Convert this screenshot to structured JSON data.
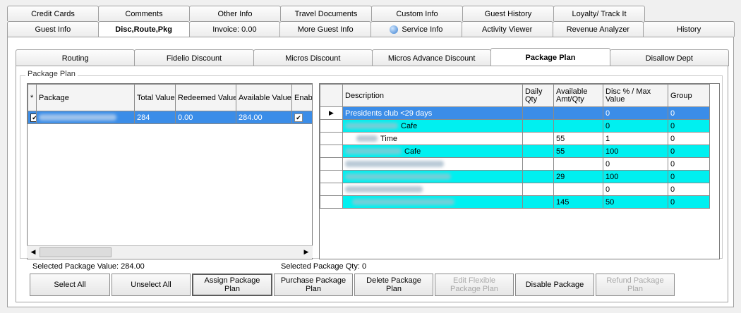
{
  "tabs_row1": [
    "Credit Cards",
    "Comments",
    "Other Info",
    "Travel Documents",
    "Custom Info",
    "Guest History",
    "Loyalty/ Track It",
    ""
  ],
  "tabs_row2": [
    "Guest Info",
    "Disc,Route,Pkg",
    "Invoice: 0.00",
    "More Guest Info",
    "Service Info",
    "Activity Viewer",
    "Revenue Analyzer",
    "History"
  ],
  "subtabs": [
    "Routing",
    "Fidelio Discount",
    "Micros Discount",
    "Micros Advance Discount",
    "Package Plan",
    "Disallow Dept"
  ],
  "group_label": "Package Plan",
  "left_grid": {
    "headers": [
      "*",
      "Package",
      "Total Value",
      "Redeemed Value",
      "Available Value",
      "Enabl"
    ],
    "row": {
      "total": "284",
      "redeemed": "0.00",
      "available": "284.00"
    }
  },
  "right_grid": {
    "headers": [
      "Description",
      "Daily Qty",
      "Available Amt/Qty",
      "Disc % / Max Value",
      "Group"
    ],
    "rows": [
      {
        "desc": "Presidents club <29 days",
        "daily": "",
        "avail": "",
        "disc": "0",
        "group": "0"
      },
      {
        "desc": "Cafe",
        "daily": "",
        "avail": "",
        "disc": "0",
        "group": "0"
      },
      {
        "desc": "Time",
        "daily": "",
        "avail": "55",
        "disc": "1",
        "group": "0"
      },
      {
        "desc": "Cafe",
        "daily": "",
        "avail": "55",
        "disc": "100",
        "group": "0"
      },
      {
        "desc": "",
        "daily": "",
        "avail": "",
        "disc": "0",
        "group": "0"
      },
      {
        "desc": "",
        "daily": "",
        "avail": "29",
        "disc": "100",
        "group": "0"
      },
      {
        "desc": "",
        "daily": "",
        "avail": "",
        "disc": "0",
        "group": "0"
      },
      {
        "desc": "",
        "daily": "",
        "avail": "145",
        "disc": "50",
        "group": "0"
      }
    ]
  },
  "status": {
    "selected_value": "Selected Package Value: 284.00",
    "selected_qty": "Selected Package Qty: 0"
  },
  "buttons": {
    "select_all": "Select All",
    "unselect_all": "Unselect All",
    "assign": "Assign Package Plan",
    "purchase": "Purchase Package Plan",
    "delete": "Delete Package Plan",
    "edit_flexible": "Edit Flexible Package Plan",
    "disable": "Disable Package",
    "refund": "Refund Package Plan"
  },
  "scroll": {
    "left_arrow": "◀",
    "right_arrow": "▶",
    "row_pointer": "▶"
  },
  "colors": {
    "selection": "#3b8de8",
    "highlight": "#00f0f0"
  }
}
